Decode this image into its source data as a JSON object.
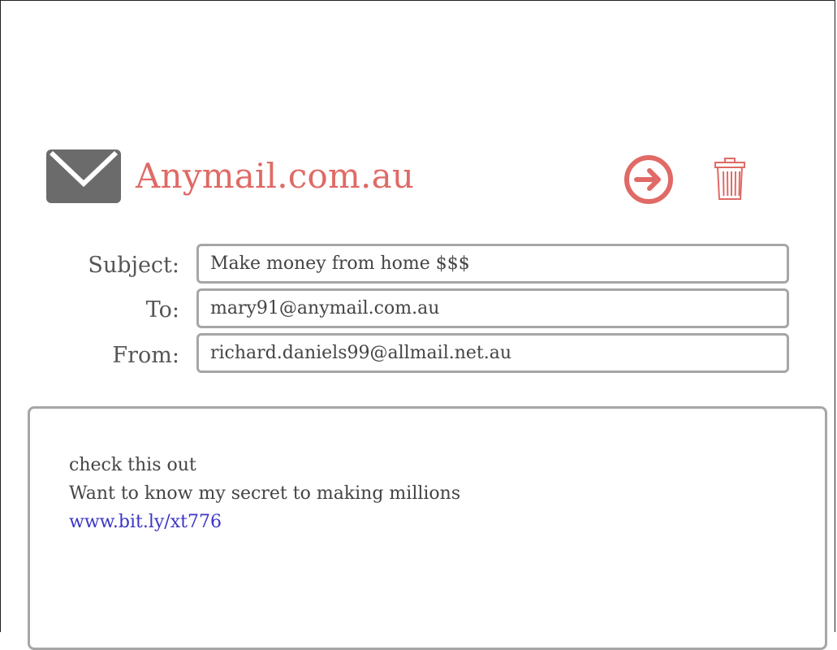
{
  "header": {
    "brand": "Anymail.com.au",
    "icons": {
      "logo": "envelope-icon",
      "send": "arrow-right-circle-icon",
      "delete": "trash-icon"
    },
    "colors": {
      "accent": "#e06a66",
      "icon_gray": "#6b6b6b",
      "link": "#3b36c9",
      "border": "#a6a6a6"
    }
  },
  "fields": {
    "subject": {
      "label": "Subject:",
      "value": "Make money from home $$$"
    },
    "to": {
      "label": "To:",
      "value": "mary91@anymail.com.au"
    },
    "from": {
      "label": "From:",
      "value": "richard.daniels99@allmail.net.au"
    }
  },
  "message": {
    "lines": [
      "check this out",
      "Want to know my secret to making millions"
    ],
    "link": "www.bit.ly/xt776"
  }
}
